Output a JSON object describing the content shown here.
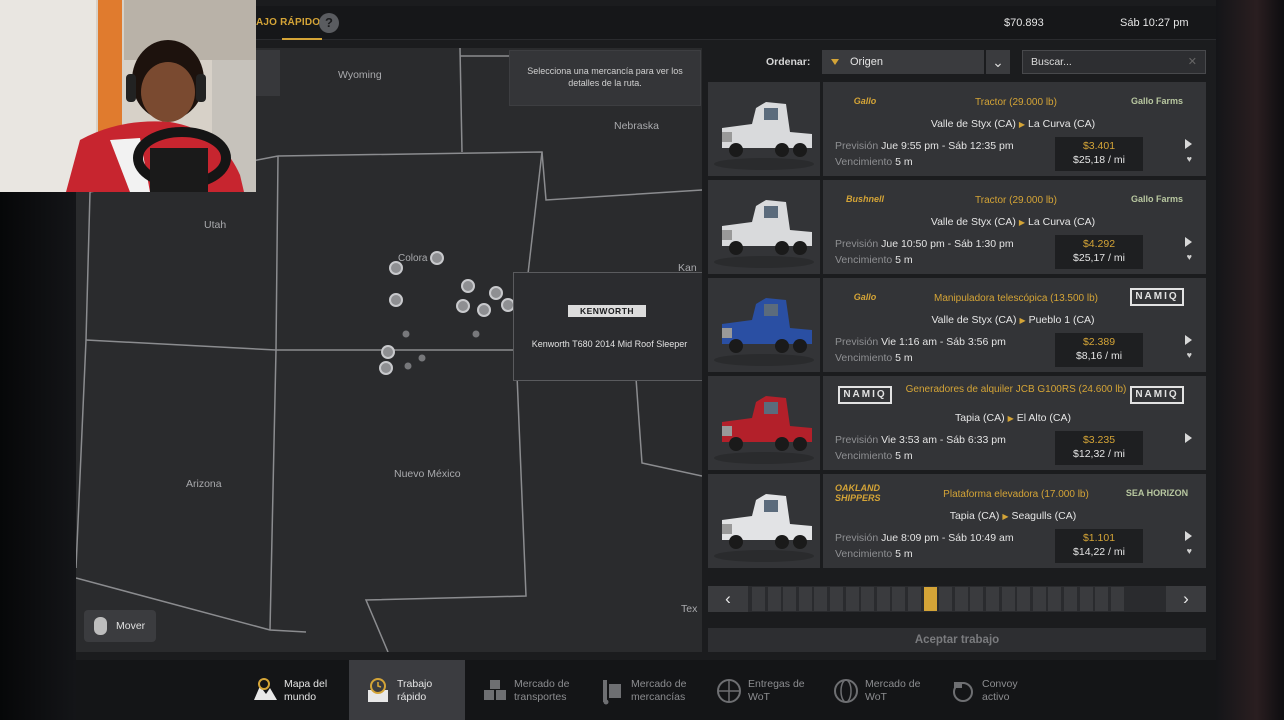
{
  "topbar": {
    "title": "AJO RÁPIDO",
    "help_label": "?",
    "money": "$70.893",
    "clock": "Sáb 10:27 pm"
  },
  "map": {
    "hint": "Selecciona una mercancía para ver los detalles de la ruta.",
    "states": [
      "Wyoming",
      "Nebraska",
      "Utah",
      "Colora",
      "Kan",
      "Arizona",
      "Nuevo México",
      "Tex"
    ],
    "tooltip": {
      "brand": "KENWORTH",
      "model": "Kenworth T680 2014 Mid Roof Sleeper"
    },
    "mover_label": "Mover"
  },
  "sort": {
    "label": "Ordenar:",
    "value": "Origen"
  },
  "search": {
    "placeholder": "Buscar..."
  },
  "jobs": [
    {
      "company": "Gallo",
      "cargo": "Tractor (29.000 lb)",
      "from": "Valle de Styx (CA)",
      "to": "La Curva (CA)",
      "forecast_label": "Previsión",
      "forecast": "Jue 9:55 pm - Sáb 12:35 pm",
      "due_label": "Vencimiento",
      "due": "5 m",
      "pay": "$3.401",
      "rate": "$25,18 / mi",
      "dest_logo": "Gallo Farms",
      "truck_color": "#d9dadc"
    },
    {
      "company": "Bushnell",
      "cargo": "Tractor (29.000 lb)",
      "from": "Valle de Styx (CA)",
      "to": "La Curva (CA)",
      "forecast_label": "Previsión",
      "forecast": "Jue 10:50 pm - Sáb 1:30 pm",
      "due_label": "Vencimiento",
      "due": "5 m",
      "pay": "$4.292",
      "rate": "$25,17 / mi",
      "dest_logo": "Gallo Farms",
      "truck_color": "#d9dadc"
    },
    {
      "company": "Gallo",
      "cargo": "Manipuladora telescópica (13.500 lb)",
      "from": "Valle de Styx (CA)",
      "to": "Pueblo 1 (CA)",
      "forecast_label": "Previsión",
      "forecast": "Vie 1:16 am - Sáb 3:56 pm",
      "due_label": "Vencimiento",
      "due": "5 m",
      "pay": "$2.389",
      "rate": "$8,16 / mi",
      "dest_logo": "NAMIQ",
      "truck_color": "#2a4fa3"
    },
    {
      "company": "NAMIQ",
      "cargo": "Generadores de alquiler JCB G100RS (24.600 lb)",
      "from": "Tapia (CA)",
      "to": "El Alto (CA)",
      "forecast_label": "Previsión",
      "forecast": "Vie 3:53 am - Sáb 6:33 pm",
      "due_label": "Vencimiento",
      "due": "5 m",
      "pay": "$3.235",
      "rate": "$12,32 / mi",
      "dest_logo": "NAMIQ",
      "truck_color": "#b3202a"
    },
    {
      "company": "OAKLAND SHIPPERS",
      "cargo": "Plataforma elevadora (17.000 lb)",
      "from": "Tapia (CA)",
      "to": "Seagulls (CA)",
      "forecast_label": "Previsión",
      "forecast": "Jue 8:09 pm - Sáb 10:49 am",
      "due_label": "Vencimiento",
      "due": "5 m",
      "pay": "$1.101",
      "rate": "$14,22 / mi",
      "dest_logo": "SEA HORIZON",
      "truck_color": "#e2e3e5"
    }
  ],
  "pager": {
    "prev": "‹",
    "next": "›",
    "total_pages": 24,
    "current_page": 12
  },
  "accept_label": "Aceptar trabajo",
  "bottomnav": [
    {
      "label": "Mapa del\nmundo",
      "icon": "world-map-icon"
    },
    {
      "label": "Trabajo\nrápido",
      "icon": "clock-box-icon"
    },
    {
      "label": "Mercado de\ntransportes",
      "icon": "crates-icon"
    },
    {
      "label": "Mercado de\nmercancías",
      "icon": "hand-truck-icon"
    },
    {
      "label": "Entregas de\nWoT",
      "icon": "globe-box-icon"
    },
    {
      "label": "Mercado de\nWoT",
      "icon": "globe-icon"
    },
    {
      "label": "Convoy\nactivo",
      "icon": "convoy-icon"
    }
  ],
  "colors": {
    "accent": "#d4a437",
    "panel": "#333437",
    "map_bg": "#2a2b2d"
  }
}
